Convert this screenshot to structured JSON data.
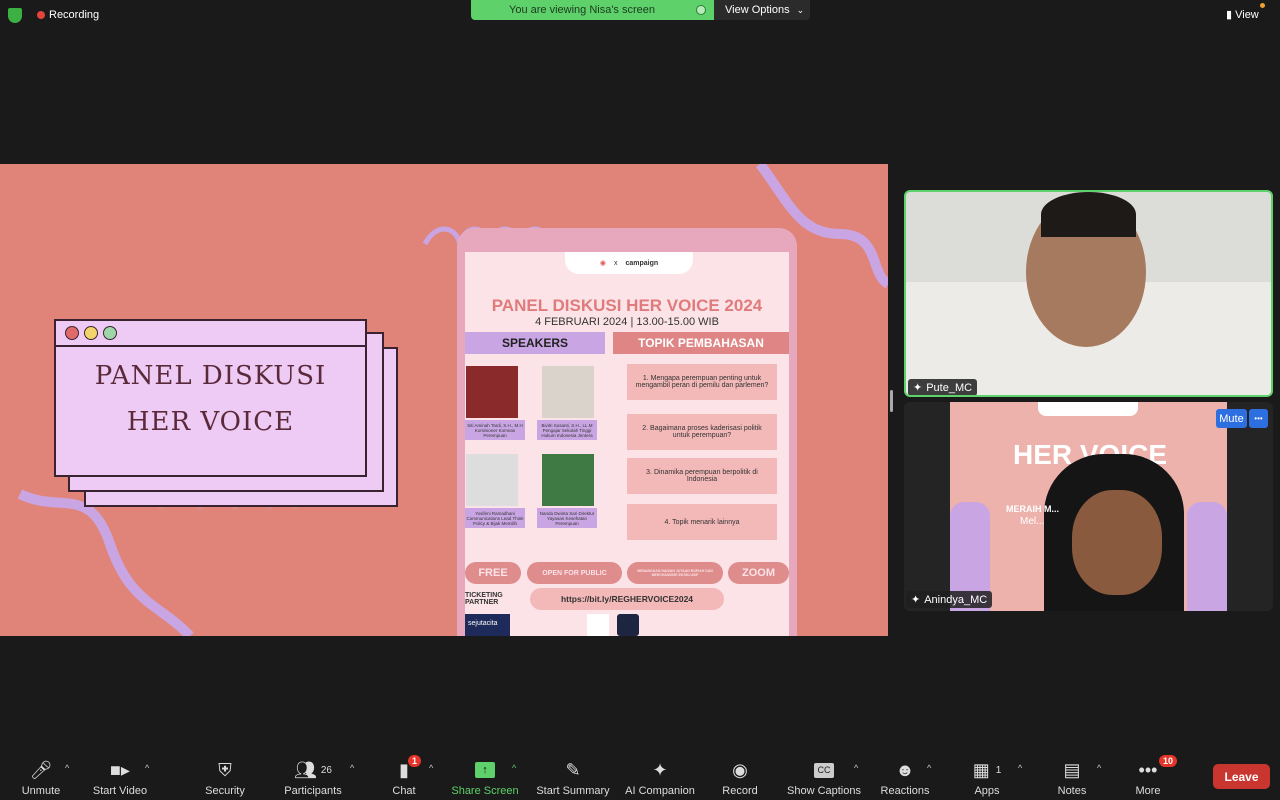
{
  "top": {
    "recording": "Recording",
    "viewing_banner": "You are viewing Nisa's screen",
    "view_options": "View Options",
    "view": "View"
  },
  "share": {
    "slide_title_line1": "PANEL DISKUSI",
    "slide_title_line2": "HER VOICE",
    "poster": {
      "partner_logo": "campaign",
      "x": "x",
      "heading": "PANEL DISKUSI HER VOICE  2024",
      "date": "4 FEBRUARI 2024 | 13.00-15.00 WIB",
      "speakers_label": "SPEAKERS",
      "topics_label": "TOPIK PEMBAHASAN",
      "speakers": [
        "Siti Aminah Tardi, S.H., M.H Komisioner Komnas Perempuan",
        "Bivitri Susanti, S.H., LL.M Pengajar Sekolah Tinggi Hukum Indonesia Jentera",
        "Yosifeni Ramadhani Communications Lead Think Policy & Bijak Memilih",
        "Nanda Dwinta Sari Direktur Yayasan Kesehatan Perempuan"
      ],
      "topics": [
        "1. Mengapa perempuan penting untuk mengambil peran di pemilu dan parlemen?",
        "2. Bagaimana proses kaderisasi politik untuk perempuan?",
        "3. Dinamika perempuan berpolitik di Indonesia",
        "4. Topik menarik lainnya"
      ],
      "pills": [
        "FREE",
        "OPEN FOR PUBLIC",
        "MENANGKAN HADIAH JUTAAN RUPIAH DAN MERCHANDISE EKSKLUSIF",
        "ZOOM"
      ],
      "link": "https://bit.ly/REGHERVOICE2024",
      "ticketing": "TICKETING PARTNER",
      "ticket_logo": "sejutacita"
    }
  },
  "participants": [
    {
      "name": "Pute_MC",
      "active": true
    },
    {
      "name": "Anindya_MC",
      "mute_label": "Mute",
      "more_label": "•••",
      "bg_text": "HER VOICE 2024",
      "bg_sub": "MERAIH M...",
      "bg_sub2": "Mel..."
    }
  ],
  "toolbar": {
    "items": [
      {
        "label": "Unmute",
        "icon": "mic-muted-icon"
      },
      {
        "label": "Start Video",
        "icon": "video-off-icon"
      },
      {
        "label": "Security",
        "icon": "shield-icon"
      },
      {
        "label": "Participants",
        "icon": "participants-icon",
        "count": "26"
      },
      {
        "label": "Chat",
        "icon": "chat-icon",
        "badge": "1"
      },
      {
        "label": "Share Screen",
        "icon": "share-screen-icon"
      },
      {
        "label": "Start Summary",
        "icon": "summary-icon"
      },
      {
        "label": "AI Companion",
        "icon": "sparkle-icon"
      },
      {
        "label": "Record",
        "icon": "record-icon"
      },
      {
        "label": "Show Captions",
        "icon": "cc-icon",
        "glyph": "CC"
      },
      {
        "label": "Reactions",
        "icon": "emoji-icon"
      },
      {
        "label": "Apps",
        "icon": "apps-icon",
        "count": "1"
      },
      {
        "label": "Notes",
        "icon": "notes-icon"
      },
      {
        "label": "More",
        "icon": "more-icon",
        "badge": "10"
      }
    ],
    "leave": "Leave"
  },
  "colors": {
    "accent_green": "#5ed16a",
    "leave": "#c9352f",
    "slide_bg": "#e0847a",
    "mute_blue": "#2d6fe0"
  }
}
